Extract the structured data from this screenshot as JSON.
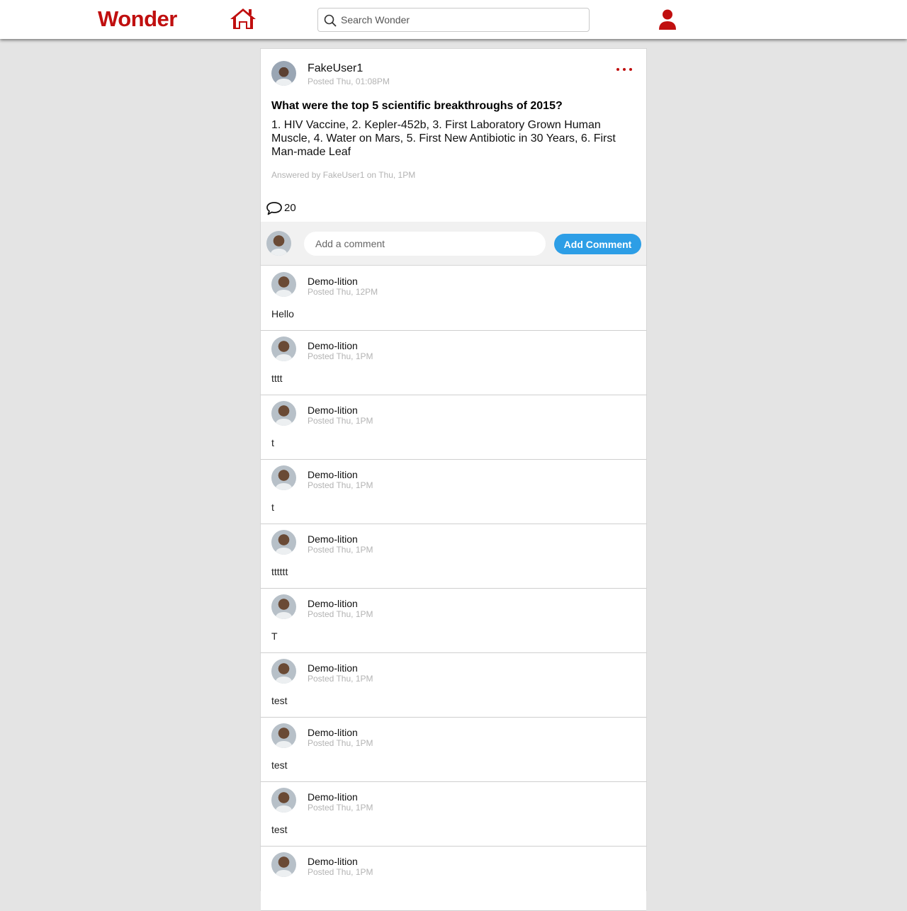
{
  "nav": {
    "logo": "Wonder",
    "search_placeholder": "Search Wonder",
    "brand_color": "#c00f0f",
    "home_icon": "home-icon",
    "profile_icon": "user-icon"
  },
  "post": {
    "author": "FakeUser1",
    "posted": "Posted Thu, 01:08PM",
    "question": "What were the top 5 scientific breakthroughs of 2015?",
    "answer": "1. HIV Vaccine, 2. Kepler-452b, 3. First Laboratory Grown Human Muscle, 4. Water on Mars, 5. First New Antibiotic in 30 Years, 6. First Man-made Leaf",
    "answered_by": "Answered by FakeUser1 on Thu, 1PM",
    "comment_count": "20"
  },
  "compose": {
    "placeholder": "Add a comment",
    "button_label": "Add Comment",
    "button_color": "#2d9ee6"
  },
  "comments": [
    {
      "author": "Demo-lition",
      "posted": "Posted Thu, 12PM",
      "text": "Hello"
    },
    {
      "author": "Demo-lition",
      "posted": "Posted Thu, 1PM",
      "text": "tttt"
    },
    {
      "author": "Demo-lition",
      "posted": "Posted Thu, 1PM",
      "text": "t"
    },
    {
      "author": "Demo-lition",
      "posted": "Posted Thu, 1PM",
      "text": "t"
    },
    {
      "author": "Demo-lition",
      "posted": "Posted Thu, 1PM",
      "text": "tttttt"
    },
    {
      "author": "Demo-lition",
      "posted": "Posted Thu, 1PM",
      "text": "T"
    },
    {
      "author": "Demo-lition",
      "posted": "Posted Thu, 1PM",
      "text": "test"
    },
    {
      "author": "Demo-lition",
      "posted": "Posted Thu, 1PM",
      "text": "test"
    },
    {
      "author": "Demo-lition",
      "posted": "Posted Thu, 1PM",
      "text": "test"
    },
    {
      "author": "Demo-lition",
      "posted": "Posted Thu, 1PM",
      "text": ""
    }
  ]
}
